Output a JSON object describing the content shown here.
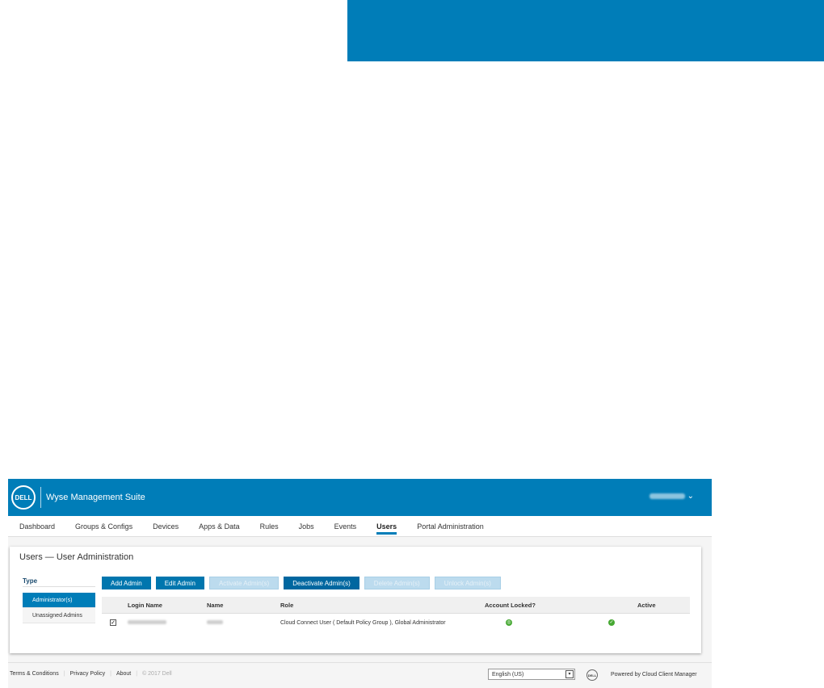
{
  "app": {
    "logo_text": "DELL",
    "title": "Wyse Management Suite",
    "user_chevron": "⌄",
    "user_email_note": "",
    "brand_color": "#007db8"
  },
  "nav": {
    "items": [
      "Dashboard",
      "Groups & Configs",
      "Devices",
      "Apps & Data",
      "Rules",
      "Jobs",
      "Events",
      "Users",
      "Portal Administration"
    ],
    "active": "Users"
  },
  "page": {
    "title": "Users — User Administration"
  },
  "type_filter": {
    "label": "Type",
    "items": [
      "Administrator(s)",
      "Unassigned Admins"
    ],
    "selected": "Administrator(s)"
  },
  "toolbar": {
    "add_admin": "Add Admin",
    "edit_admin": "Edit Admin",
    "activate_admins": "Activate Admin(s)",
    "deactivate_admins": "Deactivate Admin(s)",
    "delete_admins": "Delete Admin(s)",
    "unlock_admins": "Unlock Admin(s)"
  },
  "table": {
    "headers": {
      "login_name": "Login Name",
      "name": "Name",
      "role": "Role",
      "account_locked": "Account Locked?",
      "active": "Active"
    },
    "rows": [
      {
        "checked": "✓",
        "role": "Cloud Connect User ( Default Policy Group ), Global Administrator",
        "account_locked_icon": "unlocked-icon",
        "active_icon": "check-icon"
      }
    ]
  },
  "footer": {
    "terms": "Terms & Conditions",
    "privacy": "Privacy Policy",
    "about": "About",
    "copyright": "© 2017 Dell",
    "language": "English (US)",
    "language_caret": "▾",
    "logo_text": "DELL",
    "powered_by": "Powered by Cloud Client Manager"
  }
}
